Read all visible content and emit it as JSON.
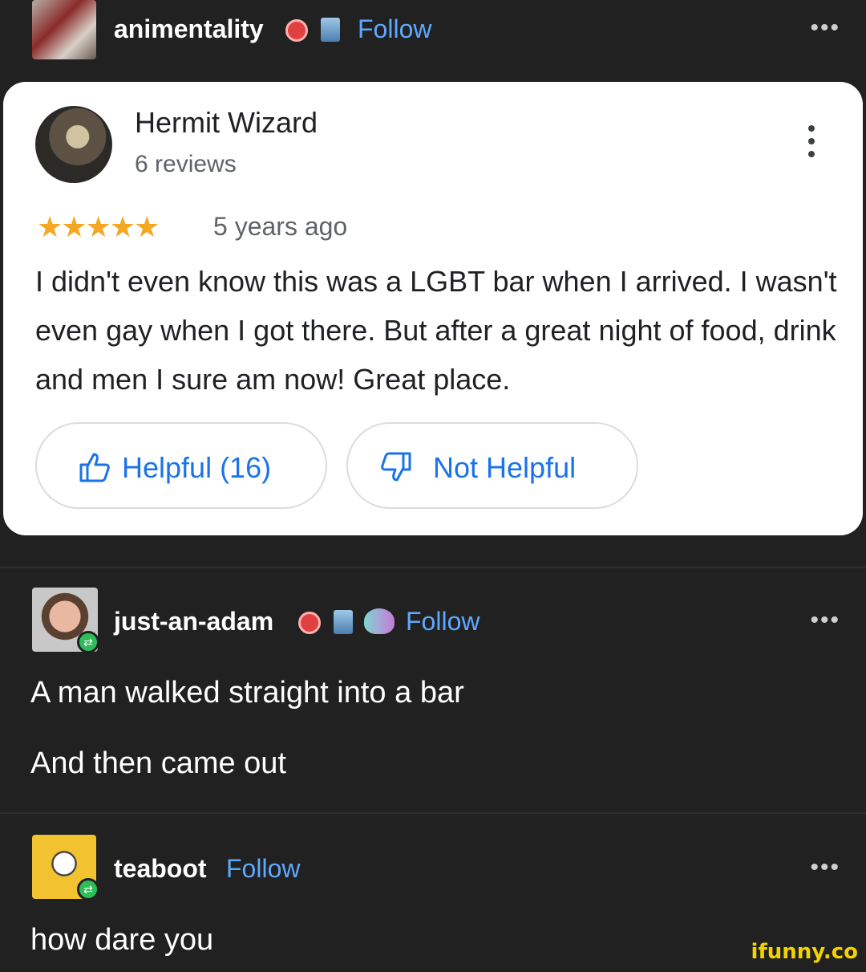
{
  "post1": {
    "username": "animentality",
    "follow_label": "Follow",
    "more_label": "•••"
  },
  "review": {
    "reviewer_name": "Hermit Wizard",
    "reviewer_count": "6 reviews",
    "rating_stars": "★★★★★",
    "rating_value": 5,
    "age": "5 years ago",
    "text": "I didn't even know this was a LGBT bar when I arrived. I wasn't even gay when I got there. But after a great night of food, drink and men I sure am now! Great place.",
    "helpful_label": "Helpful (16)",
    "not_helpful_label": "Not Helpful"
  },
  "reply1": {
    "username": "just-an-adam",
    "follow_label": "Follow",
    "more_label": "•••",
    "line1": "A man walked straight into a bar",
    "line2": "And then came out"
  },
  "reply2": {
    "username": "teaboot",
    "follow_label": "Follow",
    "more_label": "•••",
    "line1": "how dare you"
  },
  "watermark": "ifunny.co",
  "colors": {
    "background": "#212121",
    "follow": "#5fa8ff",
    "link_blue": "#1a73e8",
    "star": "#f5a623",
    "reblog": "#2fbd5a"
  }
}
